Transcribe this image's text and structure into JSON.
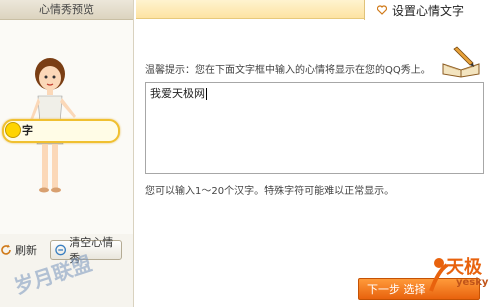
{
  "preview": {
    "title": "心情秀预览",
    "bubble_text": "字",
    "refresh_label": "刷新",
    "clear_label": "清空心情秀"
  },
  "settings": {
    "tab_label": "设置心情文字",
    "hint": "温馨提示：您在下面文字框中输入的心情将显示在您的QQ秀上。",
    "input_value": "我爱天极网",
    "note": "您可以输入1～20个汉字。特殊字符可能难以正常显示。",
    "next_label": "下一步 选择",
    "accent": "#e8620d"
  },
  "watermarks": {
    "left": "岁月联盟",
    "logo_main": "天极",
    "logo_sub": "yesky"
  }
}
